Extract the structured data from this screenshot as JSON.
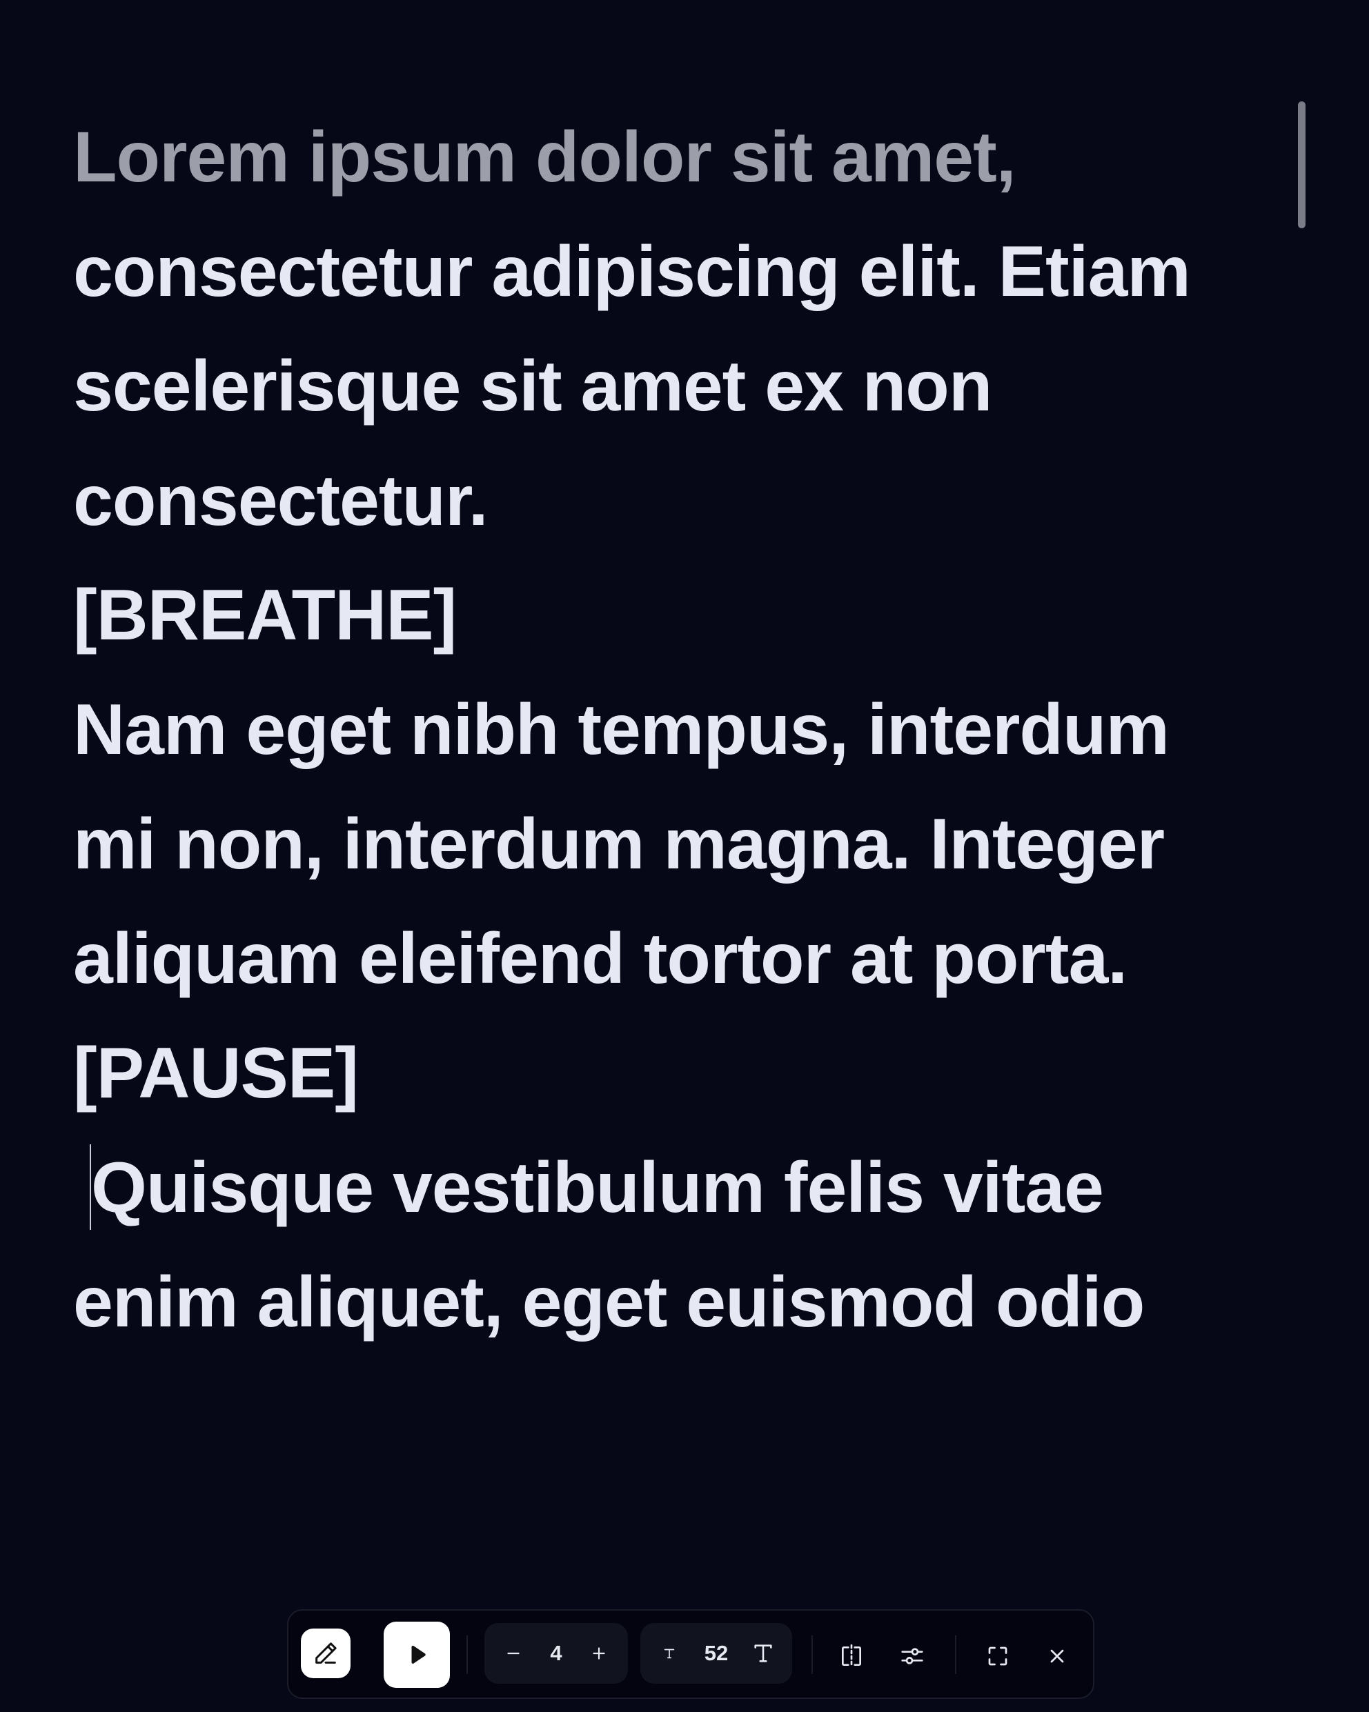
{
  "script": {
    "lines": [
      "Lorem ipsum dolor sit amet,",
      "consectetur adipiscing elit. Etiam",
      "scelerisque sit amet ex non",
      "consectetur.",
      "[BREATHE]",
      "Nam eget nibh tempus, interdum",
      "mi non, interdum magna. Integer",
      "aliquam eleifend tortor at porta.",
      "[PAUSE]",
      "Quisque vestibulum felis vitae",
      "enim aliquet, eget euismod odio"
    ]
  },
  "toolbar": {
    "speed_value": "4",
    "font_size_value": "52",
    "icons": {
      "edit": "pencil-icon",
      "play": "play-icon",
      "speed_decrease": "minus-icon",
      "speed_increase": "plus-icon",
      "font_decrease": "small-t-icon",
      "font_increase": "large-t-icon",
      "mirror": "mirror-icon",
      "settings": "sliders-icon",
      "fullscreen": "fullscreen-icon",
      "close": "close-icon"
    }
  },
  "colors": {
    "background": "#060817",
    "text": "#e6e8f3",
    "read_text": "#9c9eaa",
    "toolbar_bg": "#030410",
    "toolbar_group_bg": "#11131f"
  }
}
